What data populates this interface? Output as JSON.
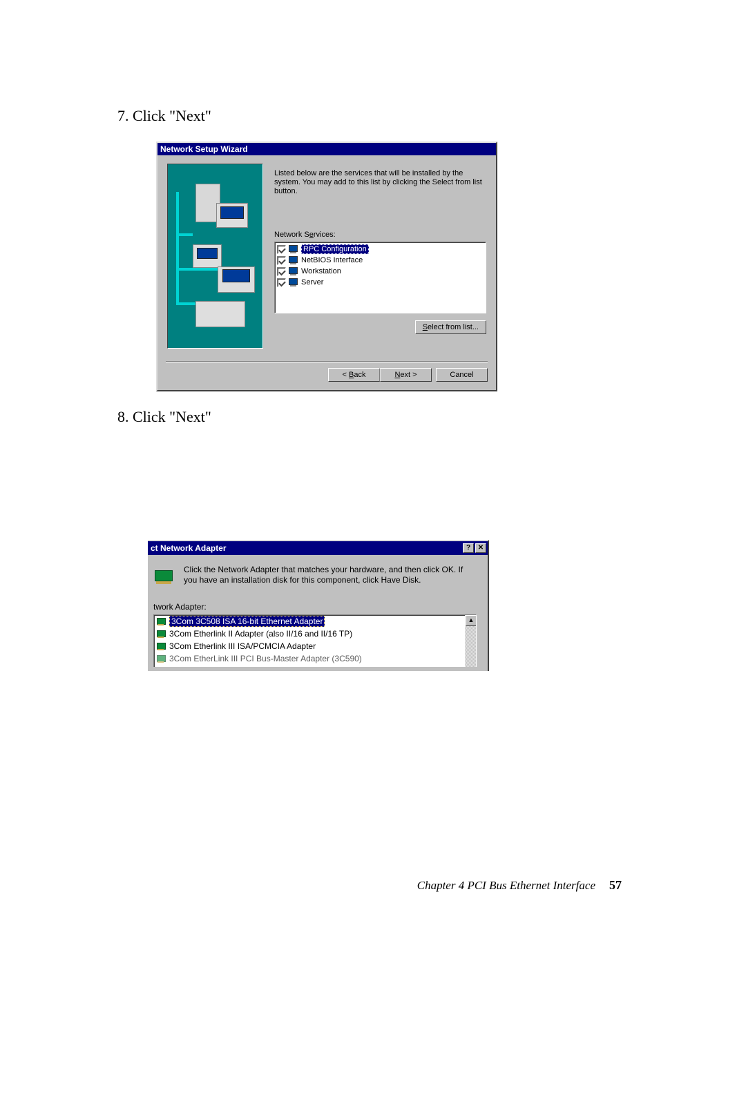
{
  "steps": {
    "s7": "7. Click \"Next\"",
    "s8": "8. Click \"Next\""
  },
  "dialog1": {
    "title": "Network Setup Wizard",
    "intro": "Listed below are the services that will be installed by the system. You may add to this list by clicking the Select from list button.",
    "services_label_pre": "Network S",
    "services_label_accel": "e",
    "services_label_post": "rvices:",
    "services": [
      {
        "label": "RPC Configuration",
        "selected": true,
        "checked": true
      },
      {
        "label": "NetBIOS Interface",
        "selected": false,
        "checked": true
      },
      {
        "label": "Workstation",
        "selected": false,
        "checked": true
      },
      {
        "label": "Server",
        "selected": false,
        "checked": true
      }
    ],
    "select_btn_pre": "",
    "select_btn_accel": "S",
    "select_btn_post": "elect from list...",
    "back_pre": "< ",
    "back_accel": "B",
    "back_post": "ack",
    "next_accel": "N",
    "next_post": "ext >",
    "cancel": "Cancel"
  },
  "dialog2": {
    "title": "ct Network Adapter",
    "help_symbol": "?",
    "close_symbol": "✕",
    "intro": "Click the Network Adapter that matches your hardware, and then click OK.  If you have an installation disk for this component, click Have Disk.",
    "list_label": "twork Adapter:",
    "adapters": [
      {
        "label": "3Com 3C508 ISA 16-bit Ethernet Adapter",
        "selected": true
      },
      {
        "label": "3Com Etherlink II Adapter (also II/16 and II/16 TP)",
        "selected": false
      },
      {
        "label": "3Com Etherlink III ISA/PCMCIA Adapter",
        "selected": false
      },
      {
        "label": "3Com EtherLink III PCI Bus-Master Adapter (3C590)",
        "selected": false
      }
    ]
  },
  "footer": {
    "chapter": "Chapter 4    PCI Bus Ethernet Interface",
    "page": "57"
  }
}
